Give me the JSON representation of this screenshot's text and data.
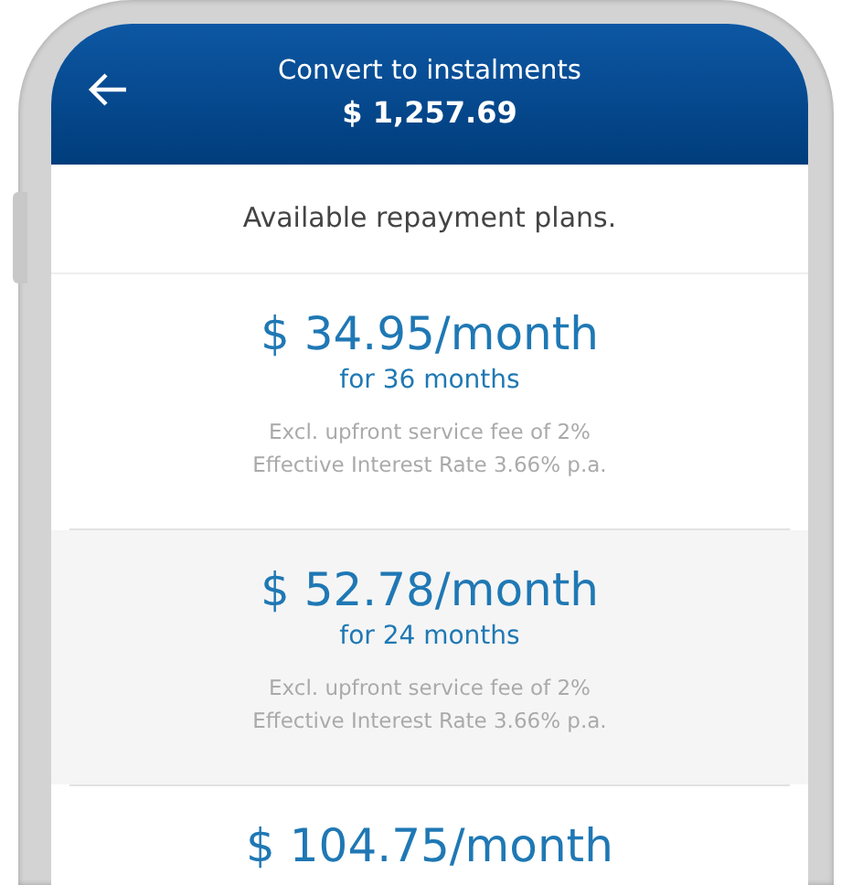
{
  "header": {
    "title": "Convert to instalments",
    "amount": "$ 1,257.69"
  },
  "intro": "Available repayment plans.",
  "plans": [
    {
      "price": "$ 34.95/month",
      "term": "for 36 months",
      "fee": "Excl. upfront service fee of 2%",
      "rate": "Effective Interest Rate 3.66% p.a."
    },
    {
      "price": "$ 52.78/month",
      "term": "for 24 months",
      "fee": "Excl. upfront service fee of 2%",
      "rate": "Effective Interest Rate 3.66% p.a."
    },
    {
      "price": "$ 104.75/month"
    }
  ]
}
